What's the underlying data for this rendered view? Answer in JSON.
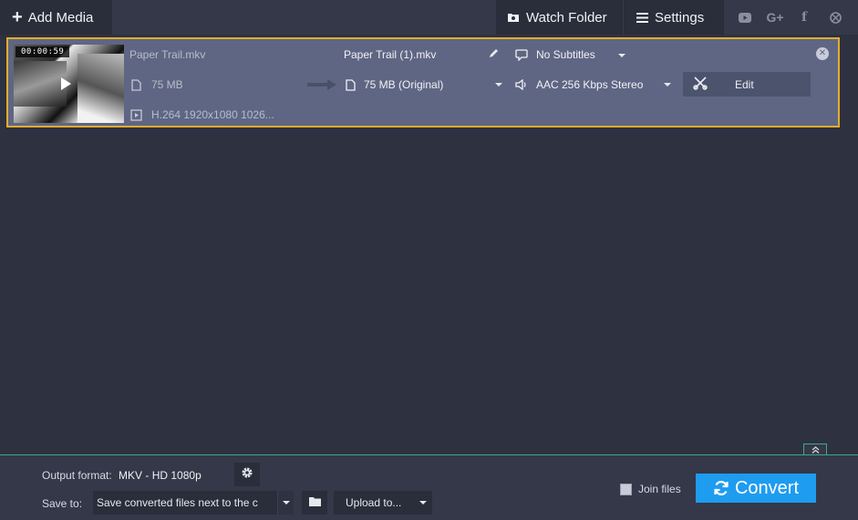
{
  "toolbar": {
    "add_media_label": "Add Media",
    "watch_folder_label": "Watch Folder",
    "settings_label": "Settings",
    "social_icons": [
      "youtube-icon",
      "google-plus-icon",
      "facebook-icon",
      "network-icon"
    ]
  },
  "file_item": {
    "duration": "00:00:59",
    "source": {
      "name": "Paper Trail.mkv",
      "size": "75 MB",
      "codec": "H.264 1920x1080 1026..."
    },
    "output": {
      "name": "Paper Trail (1).mkv",
      "size": "75 MB (Original)",
      "subtitles": "No Subtitles",
      "audio": "AAC 256 Kbps Stereo"
    },
    "edit_label": "Edit"
  },
  "bottom": {
    "output_format_label": "Output format:",
    "output_format_value": "MKV - HD 1080p",
    "save_to_label": "Save to:",
    "save_to_value": "Save converted files next to the c",
    "upload_label": "Upload to...",
    "join_label": "Join files",
    "join_checked": false,
    "convert_label": "Convert"
  },
  "colors": {
    "accent": "#1e9cf0",
    "selection_border": "#e2ad2b",
    "divider": "#3fa986"
  }
}
